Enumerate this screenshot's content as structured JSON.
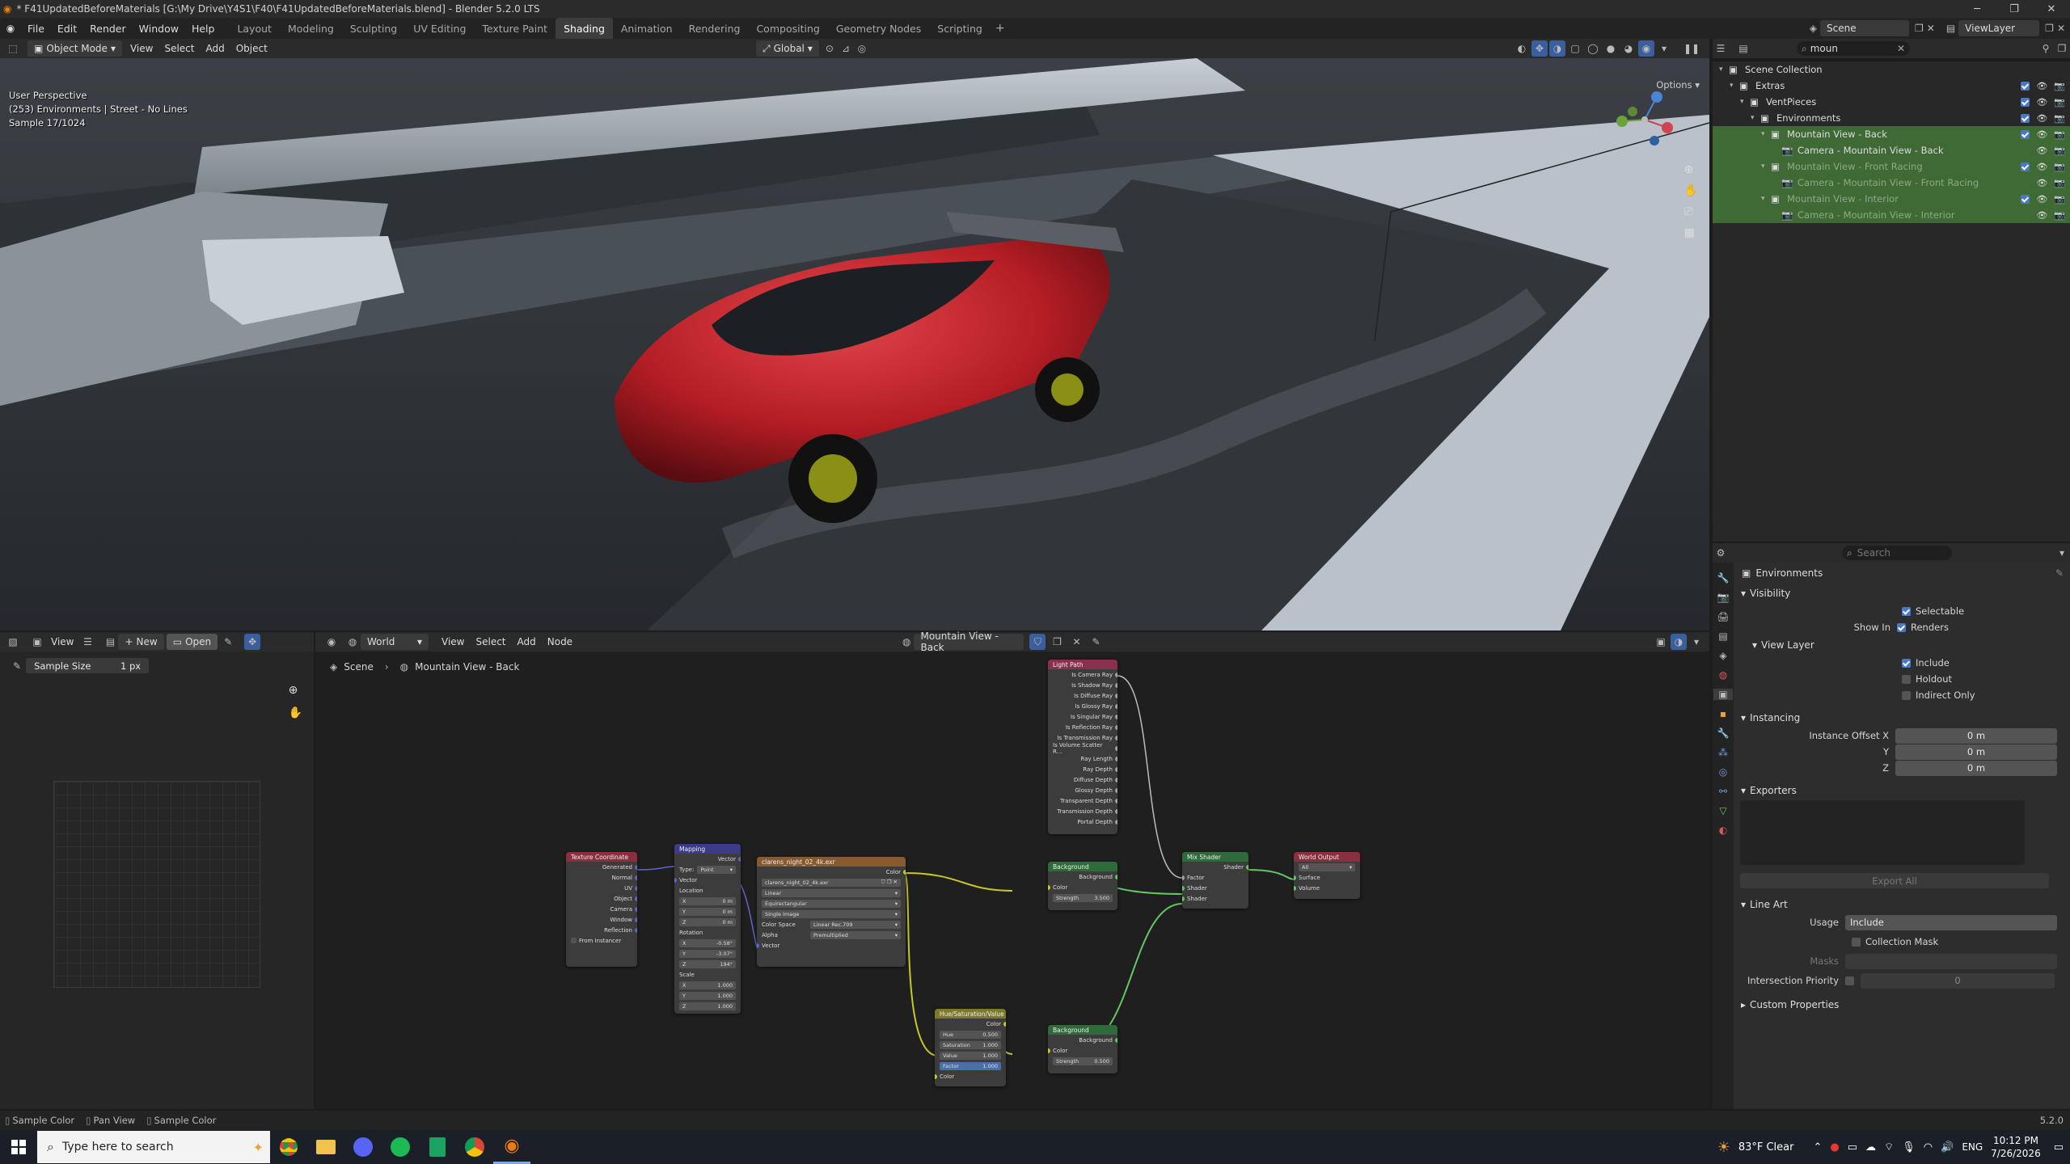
{
  "titlebar": {
    "title": "* F41UpdatedBeforeMaterials [G:\\My Drive\\Y4S1\\F40\\F41UpdatedBeforeMaterials.blend] - Blender 5.2.0 LTS"
  },
  "menu": [
    "File",
    "Edit",
    "Render",
    "Window",
    "Help"
  ],
  "workspaces": [
    "Layout",
    "Modeling",
    "Sculpting",
    "UV Editing",
    "Texture Paint",
    "Shading",
    "Animation",
    "Rendering",
    "Compositing",
    "Geometry Nodes",
    "Scripting"
  ],
  "active_workspace": "Shading",
  "scene_name": "Scene",
  "viewlayer_name": "ViewLayer",
  "viewport": {
    "mode": "Object Mode",
    "menus": [
      "View",
      "Select",
      "Add",
      "Object"
    ],
    "transform": "Global",
    "options": "Options",
    "info": [
      "User Perspective",
      "(253) Environments | Street - No Lines",
      "Sample 17/1024"
    ]
  },
  "outliner": {
    "search": "moun",
    "rows": [
      {
        "label": "Scene Collection",
        "indent": 0,
        "type": "scene",
        "sel": false,
        "dim": false
      },
      {
        "label": "Extras",
        "indent": 1,
        "type": "collection",
        "sel": false,
        "dim": false
      },
      {
        "label": "VentPieces",
        "indent": 2,
        "type": "collection",
        "sel": false,
        "dim": false
      },
      {
        "label": "Environments",
        "indent": 3,
        "type": "collection",
        "sel": false,
        "dim": false
      },
      {
        "label": "Mountain View - Back",
        "indent": 4,
        "type": "collection",
        "sel": true,
        "dim": false
      },
      {
        "label": "Camera - Mountain View - Back",
        "indent": 5,
        "type": "camera",
        "sel": true,
        "dim": false
      },
      {
        "label": "Mountain View - Front Racing",
        "indent": 4,
        "type": "collection",
        "sel": true,
        "dim": true
      },
      {
        "label": "Camera - Mountain View - Front Racing",
        "indent": 5,
        "type": "camera",
        "sel": true,
        "dim": true
      },
      {
        "label": "Mountain View - Interior",
        "indent": 4,
        "type": "collection",
        "sel": true,
        "dim": true
      },
      {
        "label": "Camera - Mountain View - Interior",
        "indent": 5,
        "type": "camera",
        "sel": true,
        "dim": true
      }
    ]
  },
  "properties": {
    "search_placeholder": "Search",
    "title": "Environments",
    "visibility": "Visibility",
    "selectable": "Selectable",
    "show_in": "Show In",
    "renders": "Renders",
    "view_layer": "View Layer",
    "include": "Include",
    "holdout": "Holdout",
    "indirect_only": "Indirect Only",
    "instancing": "Instancing",
    "instance_offset_x": "Instance Offset X",
    "y": "Y",
    "z": "Z",
    "offset_value": "0 m",
    "exporters": "Exporters",
    "export_all": "Export All",
    "line_art": "Line Art",
    "usage": "Usage",
    "usage_value": "Include",
    "collection_mask": "Collection Mask",
    "masks": "Masks",
    "intersection_priority": "Intersection Priority",
    "intersection_value": "0",
    "custom_properties": "Custom Properties"
  },
  "image_editor": {
    "view": "View",
    "new": "New",
    "open": "Open",
    "sample_size_label": "Sample Size",
    "sample_size_value": "1 px"
  },
  "node_editor": {
    "world_type": "World",
    "menus": [
      "View",
      "Select",
      "Add",
      "Node"
    ],
    "world_name": "Mountain View - Back",
    "breadcrumb": [
      "Scene",
      "Mountain View - Back"
    ]
  },
  "nodes": {
    "texcoord": {
      "title": "Texture Coordinate",
      "outputs": [
        "Generated",
        "Normal",
        "UV",
        "Object",
        "Camera",
        "Window",
        "Reflection"
      ],
      "from_instancer": "From Instancer"
    },
    "mapping": {
      "title": "Mapping",
      "out": "Vector",
      "type_label": "Type:",
      "type_value": "Point",
      "vector": "Vector",
      "location": "Location",
      "loc": [
        "X",
        "0 m",
        "Y",
        "0 m",
        "Z",
        "0 m"
      ],
      "rotation": "Rotation",
      "rot": [
        "X",
        "-0.58°",
        "Y",
        "-3.07°",
        "Z",
        "194°"
      ],
      "scale": "Scale",
      "scl": [
        "X",
        "1.000",
        "Y",
        "1.000",
        "Z",
        "1.000"
      ]
    },
    "envtex": {
      "title": "clarens_night_02_4k.exr",
      "color": "Color",
      "file": "clarens_night_02_4k.exr",
      "interp": "Linear",
      "proj": "Equirectangular",
      "source": "Single Image",
      "colorspace_label": "Color Space",
      "colorspace": "Linear Rec.709",
      "alpha_label": "Alpha",
      "alpha": "Premultiplied",
      "vector": "Vector"
    },
    "lightpath": {
      "title": "Light Path",
      "outputs": [
        "Is Camera Ray",
        "Is Shadow Ray",
        "Is Diffuse Ray",
        "Is Glossy Ray",
        "Is Singular Ray",
        "Is Reflection Ray",
        "Is Transmission Ray",
        "Is Volume Scatter R...",
        "Ray Length",
        "Ray Depth",
        "Diffuse Depth",
        "Glossy Depth",
        "Transparent Depth",
        "Transmission Depth",
        "Portal Depth"
      ]
    },
    "bg1": {
      "title": "Background",
      "out": "Background",
      "color": "Color",
      "strength_label": "Strength",
      "strength": "3.500"
    },
    "bg2": {
      "title": "Background",
      "out": "Background",
      "color": "Color",
      "strength_label": "Strength",
      "strength": "0.500"
    },
    "hsv": {
      "title": "Hue/Saturation/Value",
      "out": "Color",
      "hue_label": "Hue",
      "hue": "0.500",
      "sat_label": "Saturation",
      "sat": "1.000",
      "val_label": "Value",
      "val": "1.000",
      "fac_label": "Factor",
      "fac": "1.000",
      "color": "Color"
    },
    "mix": {
      "title": "Mix Shader",
      "out": "Shader",
      "fac": "Factor",
      "s1": "Shader",
      "s2": "Shader"
    },
    "output": {
      "title": "World Output",
      "target": "All",
      "surface": "Surface",
      "volume": "Volume"
    }
  },
  "statusbar": {
    "items": [
      "Sample Color",
      "Pan View",
      "Sample Color"
    ],
    "version": "5.2.0"
  },
  "taskbar": {
    "search_placeholder": "Type here to search",
    "weather": "83°F  Clear",
    "lang": "ENG",
    "time": "10:12 PM",
    "date": "7/26/2026"
  }
}
